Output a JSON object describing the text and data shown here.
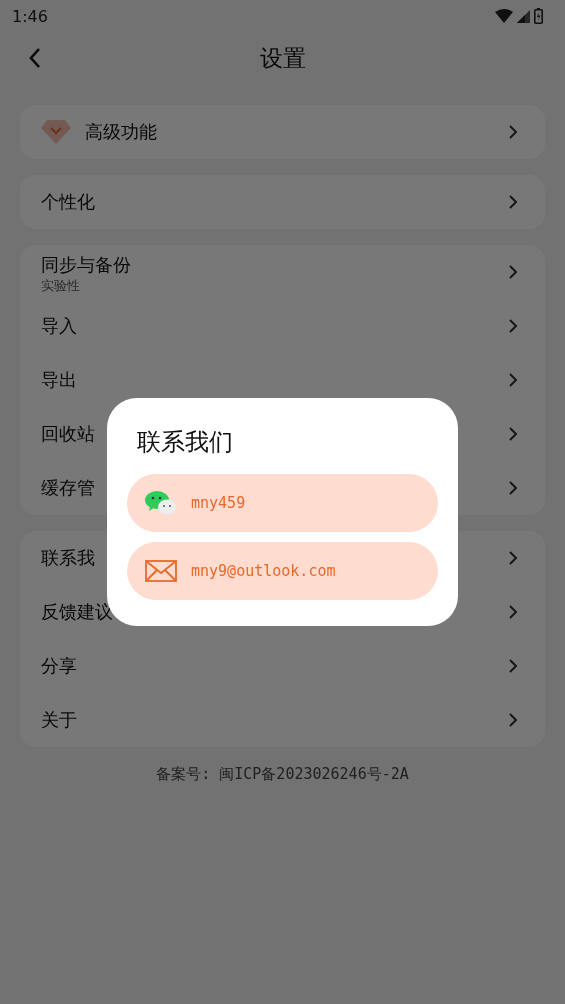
{
  "status_bar": {
    "time": "1:46"
  },
  "header": {
    "title": "设置"
  },
  "groups": [
    {
      "items": [
        {
          "label": "高级功能",
          "kind": "premium"
        }
      ]
    },
    {
      "items": [
        {
          "label": "个性化",
          "kind": "plain"
        }
      ]
    },
    {
      "items": [
        {
          "label": "同步与备份",
          "subtitle": "实验性",
          "kind": "sub"
        },
        {
          "label": "导入",
          "kind": "plain"
        },
        {
          "label": "导出",
          "kind": "plain"
        },
        {
          "label": "回收站",
          "kind": "plain"
        },
        {
          "label": "缓存管",
          "kind": "plain"
        }
      ]
    },
    {
      "items": [
        {
          "label": "联系我",
          "kind": "plain"
        },
        {
          "label": "反馈建议",
          "kind": "plain"
        },
        {
          "label": "分享",
          "kind": "plain"
        },
        {
          "label": "关于",
          "kind": "plain"
        }
      ]
    }
  ],
  "footer": "备案号: 闽ICP备2023026246号-2A",
  "dialog": {
    "title": "联系我们",
    "options": [
      {
        "kind": "wechat",
        "text": "mny459"
      },
      {
        "kind": "email",
        "text": "mny9@outlook.com"
      }
    ]
  }
}
